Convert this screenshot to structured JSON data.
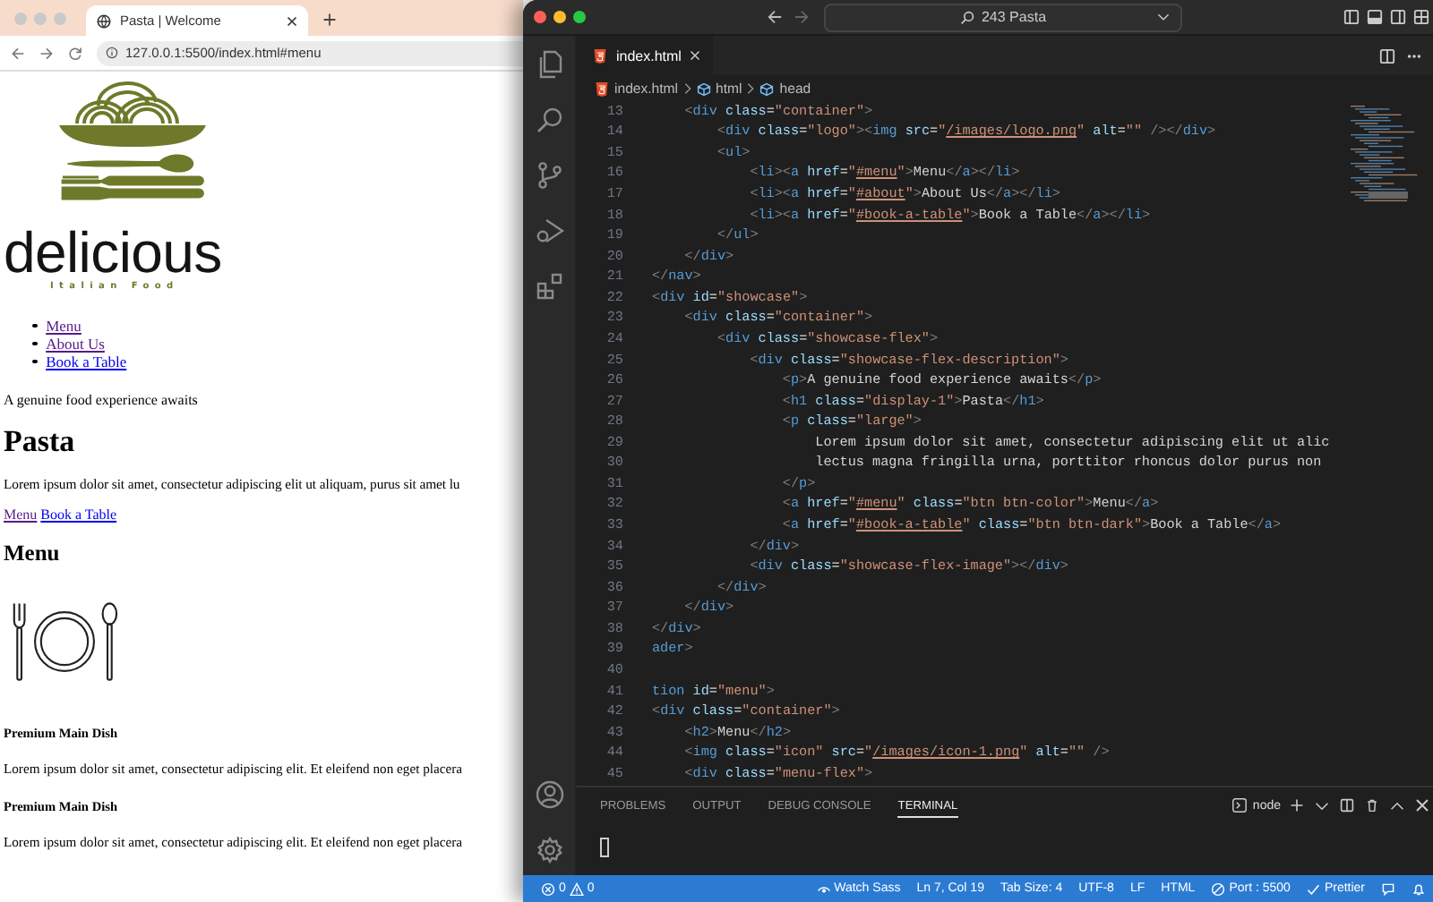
{
  "browser": {
    "tab": {
      "title": "Pasta | Welcome"
    },
    "url": "127.0.0.1:5500/index.html#menu",
    "page": {
      "logo_wordmark": "delicious",
      "logo_tagline": "Italian Food",
      "nav": [
        {
          "label": "Menu",
          "visited": true
        },
        {
          "label": "About Us",
          "visited": true
        },
        {
          "label": "Book a Table",
          "visited": false
        }
      ],
      "tagline": "A genuine food experience awaits",
      "heading": "Pasta",
      "intro": "Lorem ipsum dolor sit amet, consectetur adipiscing elit ut aliquam, purus sit amet lu",
      "buttons": [
        {
          "label": "Menu",
          "visited": true
        },
        {
          "label": "Book a Table",
          "visited": false
        }
      ],
      "menu_heading": "Menu",
      "dishes": [
        {
          "name": "Premium Main Dish",
          "description": "Lorem ipsum dolor sit amet, consectetur adipiscing elit. Et eleifend non eget placera"
        },
        {
          "name": "Premium Main Dish",
          "description": "Lorem ipsum dolor sit amet, consectetur adipiscing elit. Et eleifend non eget placera"
        }
      ]
    }
  },
  "editor": {
    "command_center": "243 Pasta",
    "tabs": [
      {
        "label": "index.html",
        "selected": true
      }
    ],
    "breadcrumbs": [
      "index.html",
      "html",
      "head"
    ],
    "lines": [
      {
        "number": "13",
        "text": "    <div class=\"container\">"
      },
      {
        "number": "14",
        "text": "        <div class=\"logo\"><img src=\"/images/logo.png\" alt=\"\" /></div>"
      },
      {
        "number": "15",
        "text": "        <ul>"
      },
      {
        "number": "16",
        "text": "            <li><a href=\"#menu\">Menu</a></li>"
      },
      {
        "number": "17",
        "text": "            <li><a href=\"#about\">About Us</a></li>"
      },
      {
        "number": "18",
        "text": "            <li><a href=\"#book-a-table\">Book a Table</a></li>"
      },
      {
        "number": "19",
        "text": "        </ul>"
      },
      {
        "number": "20",
        "text": "    </div>"
      },
      {
        "number": "21",
        "text": "</nav>"
      },
      {
        "number": "22",
        "text": "<div id=\"showcase\">"
      },
      {
        "number": "23",
        "text": "    <div class=\"container\">"
      },
      {
        "number": "24",
        "text": "        <div class=\"showcase-flex\">"
      },
      {
        "number": "25",
        "text": "            <div class=\"showcase-flex-description\">"
      },
      {
        "number": "26",
        "text": "                <p>A genuine food experience awaits</p>"
      },
      {
        "number": "27",
        "text": "                <h1 class=\"display-1\">Pasta</h1>"
      },
      {
        "number": "28",
        "text": "                <p class=\"large\">"
      },
      {
        "number": "29",
        "text": "                    Lorem ipsum dolor sit amet, consectetur adipiscing elit ut alic"
      },
      {
        "number": "30",
        "text": "                    lectus magna fringilla urna, porttitor rhoncus dolor purus non"
      },
      {
        "number": "31",
        "text": "                </p>"
      },
      {
        "number": "32",
        "text": "                <a href=\"#menu\" class=\"btn btn-color\">Menu</a>"
      },
      {
        "number": "33",
        "text": "                <a href=\"#book-a-table\" class=\"btn btn-dark\">Book a Table</a>"
      },
      {
        "number": "34",
        "text": "            </div>"
      },
      {
        "number": "35",
        "text": "            <div class=\"showcase-flex-image\"></div>"
      },
      {
        "number": "36",
        "text": "        </div>"
      },
      {
        "number": "37",
        "text": "    </div>"
      },
      {
        "number": "38",
        "text": "</div>"
      },
      {
        "number": "39",
        "text": "ader>"
      },
      {
        "number": "40"
      },
      {
        "number": "41",
        "text": "tion id=\"menu\">"
      },
      {
        "number": "42",
        "text": "<div class=\"container\">"
      },
      {
        "number": "43",
        "text": "    <h2>Menu</h2>"
      },
      {
        "number": "44",
        "text": "    <img class=\"icon\" src=\"/images/icon-1.png\" alt=\"\" />"
      },
      {
        "number": "45",
        "text": "    <div class=\"menu-flex\">"
      }
    ],
    "panel_tabs": [
      {
        "label": "PROBLEMS",
        "selected": false
      },
      {
        "label": "OUTPUT",
        "selected": false
      },
      {
        "label": "DEBUG CONSOLE",
        "selected": false
      },
      {
        "label": "TERMINAL",
        "selected": true
      }
    ],
    "terminal_profile": "node"
  },
  "status_bar": {
    "errors": "0",
    "warnings": "0",
    "items": [
      {
        "kind": "watch",
        "text": "Watch Sass"
      },
      {
        "kind": "text",
        "text": "Ln 7, Col 19"
      },
      {
        "kind": "text",
        "text": "Tab Size: 4"
      },
      {
        "kind": "text",
        "text": "UTF-8"
      },
      {
        "kind": "text",
        "text": "LF"
      },
      {
        "kind": "text",
        "text": "HTML"
      },
      {
        "kind": "port",
        "text": "Port : 5500"
      },
      {
        "kind": "check",
        "text": "Prettier"
      }
    ]
  }
}
